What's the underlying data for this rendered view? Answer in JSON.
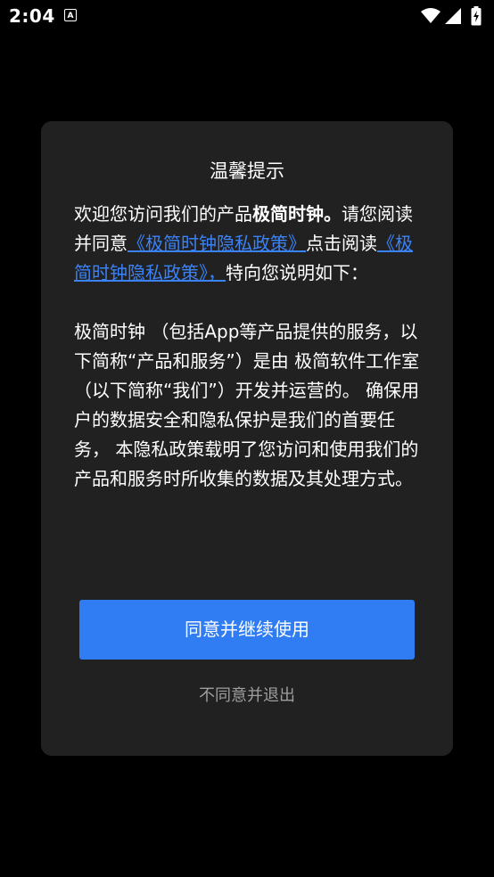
{
  "status_bar": {
    "time": "2:04",
    "notification_icon": "a-icon",
    "wifi_icon": "wifi-icon",
    "signal_icon": "signal-icon",
    "battery_icon": "battery-charging-icon"
  },
  "dialog": {
    "title": "温馨提示",
    "para1": {
      "t1": "欢迎您访问我们的产品",
      "product_name": "极简时钟。",
      "t2": "请您阅读并同意",
      "link1": "《极简时钟隐私政策》",
      "t3": "点击阅读",
      "link2": "《极简时钟隐私政策》，",
      "t4": "特向您说明如下："
    },
    "para2": "极简时钟 （包括App等产品提供的服务，以下简称“产品和服务”）是由 极简软件工作室 （以下简称“我们”）开发并运营的。 确保用户的数据安全和隐私保护是我们的首要任务， 本隐私政策载明了您访问和使用我们的产品和服务时所收集的数据及其处理方式。",
    "agree_label": "同意并继续使用",
    "exit_label": "不同意并退出"
  },
  "colors": {
    "background": "#000000",
    "dialog": "#212121",
    "accent": "#2f7cf3",
    "link": "#3b82f6",
    "muted": "#9e9e9e"
  }
}
